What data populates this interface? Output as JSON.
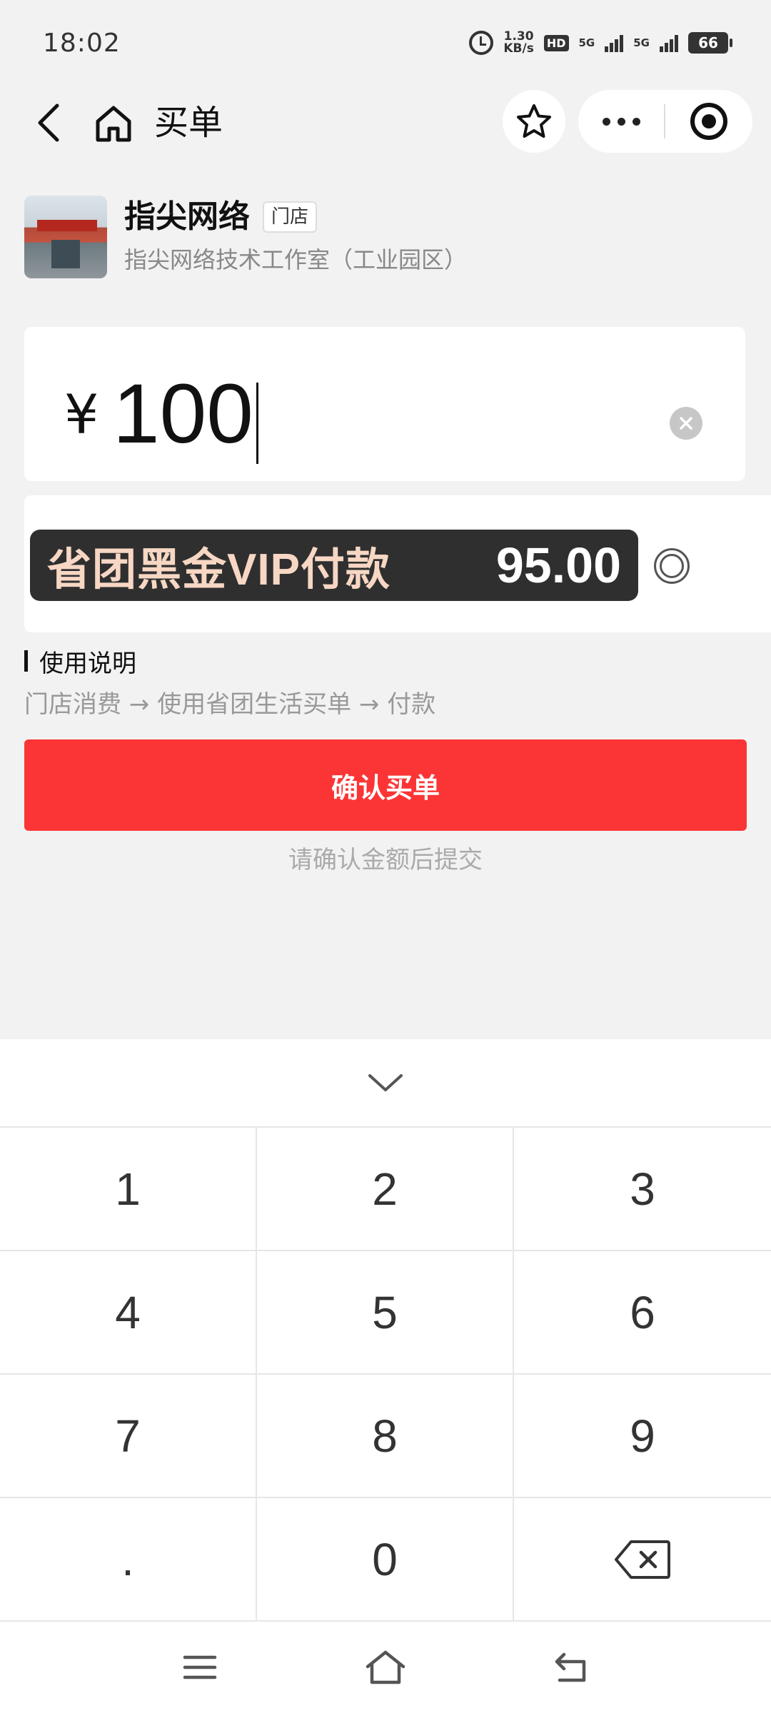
{
  "status_bar": {
    "time": "18:02",
    "net_speed_value": "1.30",
    "net_speed_unit": "KB/s",
    "hd_label": "HD",
    "sim1_label": "5G",
    "sim2_label": "5G",
    "battery": "66"
  },
  "nav": {
    "title": "买单"
  },
  "store": {
    "name": "指尖网络",
    "tag": "门店",
    "branch": "指尖网络技术工作室（工业园区）"
  },
  "amount": {
    "currency_symbol": "¥",
    "value": "100"
  },
  "vip_payment": {
    "label": "省团黑金VIP付款",
    "price": "95.00"
  },
  "usage": {
    "title": "使用说明",
    "steps": "门店消费 → 使用省团生活买单 → 付款"
  },
  "confirm": {
    "label": "确认买单",
    "hint": "请确认金额后提交"
  },
  "keypad": {
    "keys": [
      "1",
      "2",
      "3",
      "4",
      "5",
      "6",
      "7",
      "8",
      "9",
      ".",
      "0"
    ]
  },
  "colors": {
    "accent_red": "#fb3535",
    "vip_banner_bg": "#2f2f2f",
    "vip_label": "#f7d7c4",
    "page_bg": "#f2f2f2"
  },
  "icons": {
    "back": "chevron-left-icon",
    "home": "home-icon",
    "favorite": "star-icon",
    "more": "more-dots-icon",
    "miniapp_close": "target-icon",
    "clear": "clear-icon",
    "collapse": "chevron-down-icon",
    "backspace": "backspace-icon"
  }
}
